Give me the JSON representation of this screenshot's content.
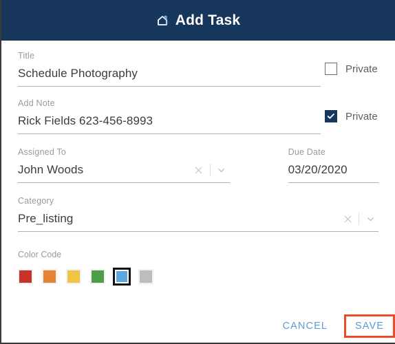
{
  "header": {
    "title": "Add Task",
    "icon": "home-icon",
    "background_color": "#17365c",
    "title_color": "#ffffff",
    "icon_accent_color": "#7fb5dd"
  },
  "form": {
    "title_field": {
      "label": "Title",
      "value": "Schedule Photography"
    },
    "title_private": {
      "label": "Private",
      "checked": false
    },
    "note_field": {
      "label": "Add Note",
      "value": "Rick Fields 623-456-8993"
    },
    "note_private": {
      "label": "Private",
      "checked": true
    },
    "assigned_to": {
      "label": "Assigned To",
      "value": "John Woods",
      "clear_icon": "close-x-icon",
      "dropdown_icon": "chevron-down-icon"
    },
    "due_date": {
      "label": "Due Date",
      "value": "03/20/2020"
    },
    "category": {
      "label": "Category",
      "value": "Pre_listing",
      "clear_icon": "close-x-icon",
      "dropdown_icon": "chevron-down-icon"
    },
    "color_code": {
      "label": "Color Code",
      "selected_index": 4,
      "swatches": [
        {
          "name": "red",
          "color": "#c9322a"
        },
        {
          "name": "orange",
          "color": "#e58435"
        },
        {
          "name": "yellow",
          "color": "#f0c447"
        },
        {
          "name": "green",
          "color": "#4d9e47"
        },
        {
          "name": "blue",
          "color": "#5fa8de"
        },
        {
          "name": "gray",
          "color": "#bdbdbd"
        }
      ]
    }
  },
  "footer": {
    "cancel_label": "CANCEL",
    "save_label": "SAVE",
    "button_color": "#5b9bd5",
    "highlight_color": "#f04a23"
  }
}
